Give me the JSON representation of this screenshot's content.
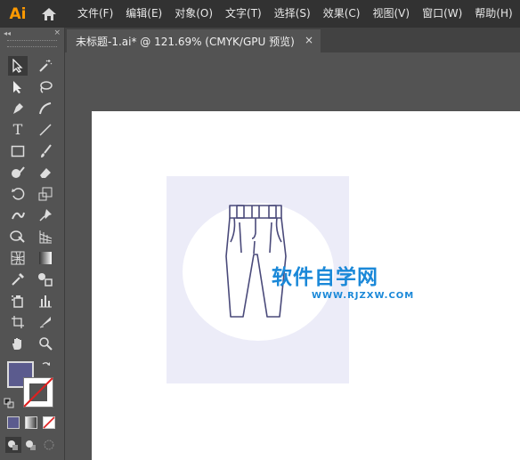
{
  "app": {
    "logo_text": "Ai"
  },
  "menu": [
    "文件(F)",
    "编辑(E)",
    "对象(O)",
    "文字(T)",
    "选择(S)",
    "效果(C)",
    "视图(V)",
    "窗口(W)",
    "帮助(H)"
  ],
  "toolbar": {
    "collapse_glyph": "◂◂",
    "close_glyph": "×"
  },
  "document_tab": {
    "label": "未标题-1.ai* @ 121.69% (CMYK/GPU 预览)",
    "close_glyph": "×"
  },
  "colors": {
    "fill": "#5b5b8e",
    "artwork_bg": "#ececf8",
    "pants_stroke": "#4a4a7a",
    "watermark": "#1a88d8",
    "accent": "#ff9a00"
  },
  "watermark": {
    "title": "软件自学网",
    "subtitle": "WWW.RJZXW.COM"
  },
  "icons": [
    "home-icon",
    "selection-tool-icon",
    "magic-wand-icon",
    "direct-selection-icon",
    "lasso-icon",
    "pen-icon",
    "curvature-icon",
    "type-icon",
    "line-icon",
    "rectangle-icon",
    "paintbrush-icon",
    "shaper-icon",
    "eraser-icon",
    "rotate-icon",
    "scale-icon",
    "warp-icon",
    "puppet-warp-icon",
    "shape-builder-icon",
    "perspective-icon",
    "mesh-icon",
    "gradient-icon",
    "eyedropper-icon",
    "blend-icon",
    "symbol-sprayer-icon",
    "column-graph-icon",
    "artboard-icon",
    "slice-icon",
    "hand-icon",
    "zoom-icon",
    "swap-icon",
    "default-colors-icon",
    "color-mode-icon",
    "gradient-mode-icon",
    "none-mode-icon",
    "draw-normal-icon",
    "draw-behind-icon",
    "draw-inside-icon"
  ]
}
